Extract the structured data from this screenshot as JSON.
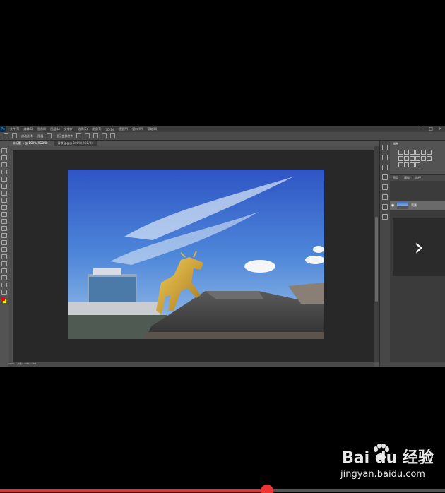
{
  "app": {
    "name": "Adobe Photoshop",
    "menu": [
      "文件(F)",
      "编辑(E)",
      "图像(I)",
      "图层(L)",
      "文字(Y)",
      "选择(S)",
      "滤镜(T)",
      "3D(D)",
      "视图(V)",
      "窗口(W)",
      "帮助(H)"
    ],
    "window_controls": [
      "—",
      "□",
      "×"
    ]
  },
  "options_bar": {
    "auto_select_label": "自动选择:",
    "auto_select_value": "图层",
    "show_transform_label": "显示变换控件"
  },
  "tabs": [
    {
      "label": "未标题-1 @ 100%(RGB/8)",
      "active": true
    },
    {
      "label": "背景.jpg @ 100%(RGB/8)",
      "active": false
    }
  ],
  "status_bar": {
    "zoom": "100%",
    "doc_info": "文档:2.25M/2.25M"
  },
  "panels": {
    "adjustments_title": "调整",
    "layers_tabs": [
      "图层",
      "通道",
      "路径"
    ],
    "layer_name": "背景"
  },
  "overlay": {
    "next_icon": "chevron-right-icon"
  },
  "watermark": {
    "brand": "Bai du 经验",
    "url": "jingyan.baidu.com"
  },
  "video": {
    "progress_percent": 60
  },
  "colors": {
    "foreground": "#ff0000",
    "background": "#ffff00"
  }
}
